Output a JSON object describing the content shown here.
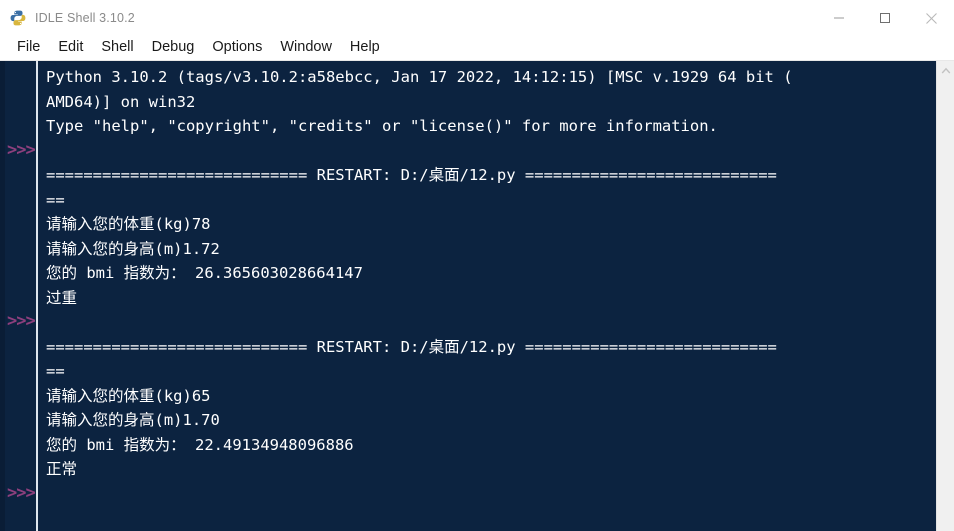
{
  "window": {
    "title": "IDLE Shell 3.10.2",
    "icon": "python-logo-icon",
    "controls": {
      "minimize": "Minimize",
      "maximize": "Maximize",
      "close": "Close"
    }
  },
  "menubar": {
    "items": [
      {
        "label": "File"
      },
      {
        "label": "Edit"
      },
      {
        "label": "Shell"
      },
      {
        "label": "Debug"
      },
      {
        "label": "Options"
      },
      {
        "label": "Window"
      },
      {
        "label": "Help"
      }
    ]
  },
  "console": {
    "background_color": "#0c2340",
    "text_color": "#ffffff",
    "prompt_color": "#8d3f7d",
    "prompt_symbol": ">>>",
    "lines": [
      "Python 3.10.2 (tags/v3.10.2:a58ebcc, Jan 17 2022, 14:12:15) [MSC v.1929 64 bit (",
      "AMD64)] on win32",
      "Type \"help\", \"copyright\", \"credits\" or \"license()\" for more information.",
      "",
      "============================ RESTART: D:/桌面/12.py ===========================",
      "==",
      "请输入您的体重(kg)78",
      "请输入您的身高(m)1.72",
      "您的 bmi 指数为： 26.365603028664147",
      "过重",
      "",
      "============================ RESTART: D:/桌面/12.py ===========================",
      "==",
      "请输入您的体重(kg)65",
      "请输入您的身高(m)1.70",
      "您的 bmi 指数为： 22.49134948096886",
      "正常",
      ""
    ],
    "prompt_line_indices": [
      3,
      10,
      17
    ]
  },
  "scrollbar": {
    "up_arrow": "chevron-up-icon",
    "orientation": "vertical"
  }
}
